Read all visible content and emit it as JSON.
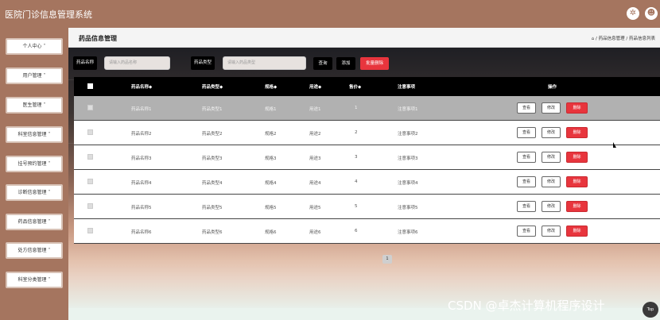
{
  "app": {
    "title": "医院门诊信息管理系统"
  },
  "header_icons": [
    "settings-icon",
    "user-icon"
  ],
  "sidebar": {
    "items": [
      {
        "label": "个人中心 ˅"
      },
      {
        "label": "用户管理 ˅"
      },
      {
        "label": "医生管理 ˅"
      },
      {
        "label": "科室信息管理 ˅"
      },
      {
        "label": "挂号预约管理 ˅"
      },
      {
        "label": "诊断信息管理 ˅"
      },
      {
        "label": "药品信息管理 ˅"
      },
      {
        "label": "处方信息管理 ˅"
      },
      {
        "label": "科室分类管理 ˅"
      }
    ]
  },
  "page": {
    "title": "药品信息管理",
    "breadcrumb": "⌂ / 药品信息管理 / 药品信息列表"
  },
  "search": {
    "name_label": "药品名称",
    "name_placeholder": "请输入药品名称",
    "type_label": "药品类型",
    "type_placeholder": "请输入药品类型",
    "query_button": "查询",
    "add_button": "添加",
    "batch_delete_button": "批量删除"
  },
  "table": {
    "columns": [
      "药品名称◆",
      "药品类型◆",
      "规格◆",
      "用途◆",
      "售价◆",
      "注意事项",
      "操作"
    ],
    "actions": {
      "view": "查看",
      "edit": "修改",
      "delete": "删除"
    },
    "rows": [
      {
        "name": "药品名称1",
        "type": "药品类型1",
        "spec": "规格1",
        "use": "用途1",
        "price": "1",
        "note": "注意事项1"
      },
      {
        "name": "药品名称2",
        "type": "药品类型2",
        "spec": "规格2",
        "use": "用途2",
        "price": "2",
        "note": "注意事项2"
      },
      {
        "name": "药品名称3",
        "type": "药品类型3",
        "spec": "规格3",
        "use": "用途3",
        "price": "3",
        "note": "注意事项3"
      },
      {
        "name": "药品名称4",
        "type": "药品类型4",
        "spec": "规格4",
        "use": "用途4",
        "price": "4",
        "note": "注意事项4"
      },
      {
        "name": "药品名称5",
        "type": "药品类型5",
        "spec": "规格5",
        "use": "用途5",
        "price": "5",
        "note": "注意事项5"
      },
      {
        "name": "药品名称6",
        "type": "药品类型6",
        "spec": "规格6",
        "use": "用途6",
        "price": "6",
        "note": "注意事项6"
      }
    ]
  },
  "pagination": {
    "current": "1"
  },
  "watermark": "CSDN @卓杰计算机程序设计",
  "back_to_top": "Top",
  "colors": {
    "brand": "#a5755f",
    "danger": "#e8353d",
    "header": "#000000"
  }
}
